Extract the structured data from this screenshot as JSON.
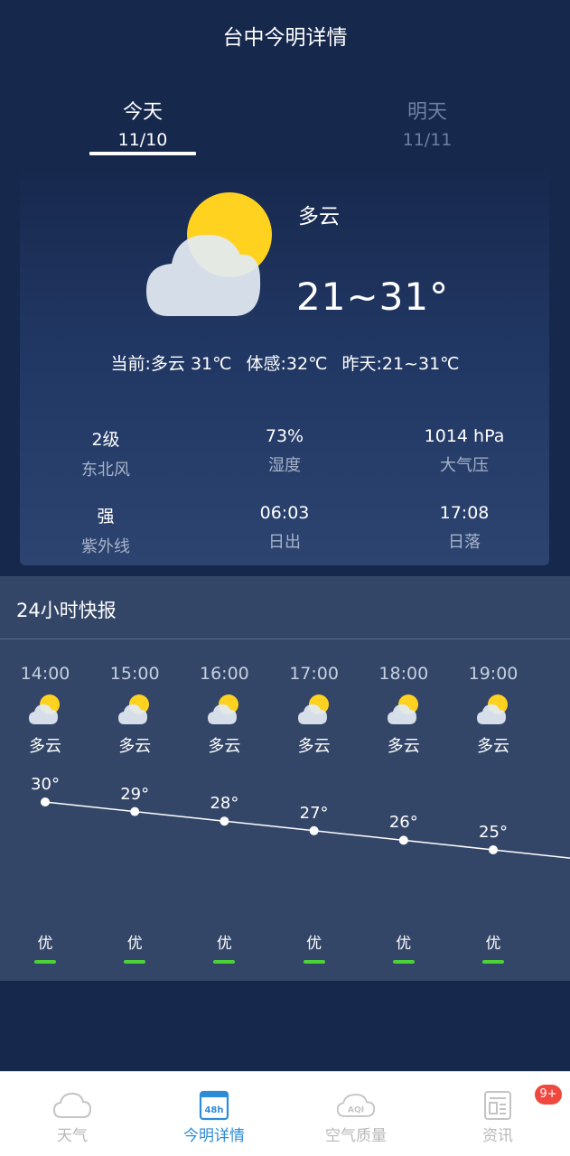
{
  "header": {
    "title": "台中今明详情"
  },
  "day_tabs": [
    {
      "label": "今天",
      "date": "11/10",
      "active": true
    },
    {
      "label": "明天",
      "date": "11/11",
      "active": false
    }
  ],
  "today": {
    "condition": "多云",
    "temp_range": "21~31°",
    "icon": "partly-cloudy-icon",
    "current": "当前:多云 31℃",
    "feels_like": "体感:32℃",
    "yesterday": "昨天:21~31℃",
    "stats": [
      {
        "value": "2级",
        "label": "东北风"
      },
      {
        "value": "73%",
        "label": "湿度"
      },
      {
        "value": "1014 hPa",
        "label": "大气压"
      },
      {
        "value": "强",
        "label": "紫外线"
      },
      {
        "value": "06:03",
        "label": "日出"
      },
      {
        "value": "17:08",
        "label": "日落"
      }
    ]
  },
  "hourly": {
    "title": "24小时快报",
    "hours": [
      {
        "time": "14:00",
        "condition": "多云",
        "temp": 30,
        "temp_label": "30°",
        "aqi": "优"
      },
      {
        "time": "15:00",
        "condition": "多云",
        "temp": 29,
        "temp_label": "29°",
        "aqi": "优"
      },
      {
        "time": "16:00",
        "condition": "多云",
        "temp": 28,
        "temp_label": "28°",
        "aqi": "优"
      },
      {
        "time": "17:00",
        "condition": "多云",
        "temp": 27,
        "temp_label": "27°",
        "aqi": "优"
      },
      {
        "time": "18:00",
        "condition": "多云",
        "temp": 26,
        "temp_label": "26°",
        "aqi": "优"
      },
      {
        "time": "19:00",
        "condition": "多云",
        "temp": 25,
        "temp_label": "25°",
        "aqi": "优"
      }
    ]
  },
  "bottom_nav": [
    {
      "label": "天气",
      "icon": "cloud-icon",
      "active": false
    },
    {
      "label": "今明详情",
      "icon": "48h-icon",
      "active": true
    },
    {
      "label": "空气质量",
      "icon": "aqi-cloud-icon",
      "active": false
    },
    {
      "label": "资讯",
      "icon": "news-icon",
      "active": false
    }
  ],
  "badge": "9+",
  "colors": {
    "background": "#17284d",
    "hourly_panel": "#344668",
    "sun": "#ffd21f",
    "cloud": "#e3ebf3",
    "aqi_good": "#4cd137",
    "nav_active": "#2d8cd8",
    "badge": "#f0483e"
  }
}
